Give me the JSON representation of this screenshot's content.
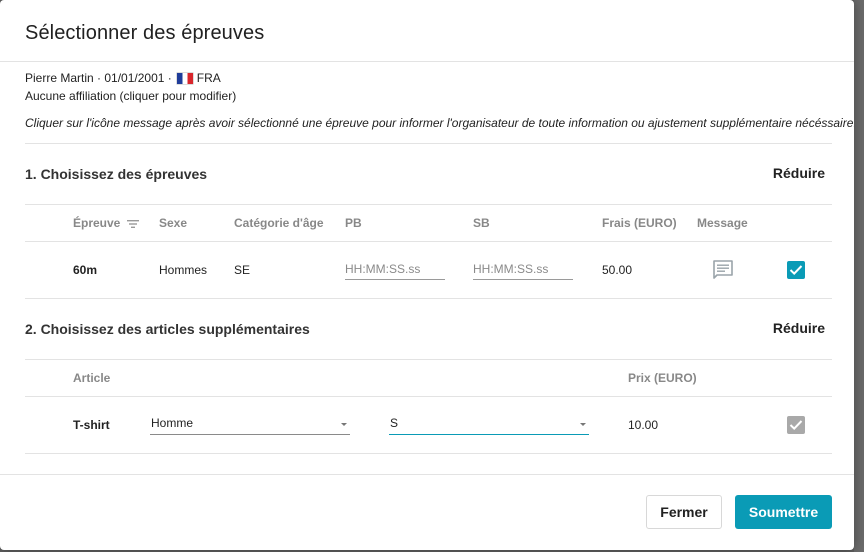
{
  "modal": {
    "title": "Sélectionner des épreuves",
    "athlete": {
      "name": "Pierre Martin",
      "separator": "·",
      "birthdate": "01/01/2001",
      "country": "FRA"
    },
    "affiliation": "Aucune affiliation (cliquer pour modifier)",
    "info_note": "Cliquer sur l'icône message après avoir sélectionné une épreuve pour informer l'organisateur de toute information ou ajustement supplémentaire nécéssaire."
  },
  "events_section": {
    "title": "1. Choisissez des épreuves",
    "collapse_label": "Réduire",
    "columns": {
      "event": "Épreuve",
      "sex": "Sexe",
      "age_category": "Catégorie d'âge",
      "pb": "PB",
      "sb": "SB",
      "fee": "Frais (EURO)",
      "message": "Message"
    },
    "rows": [
      {
        "event": "60m",
        "sex": "Hommes",
        "age_category": "SE",
        "pb_placeholder": "HH:MM:SS.ss",
        "sb_placeholder": "HH:MM:SS.ss",
        "fee": "50.00",
        "selected": true
      }
    ]
  },
  "items_section": {
    "title": "2. Choisissez des articles supplémentaires",
    "collapse_label": "Réduire",
    "columns": {
      "article": "Article",
      "price": "Prix (EURO)"
    },
    "rows": [
      {
        "article": "T-shirt",
        "variant": "Homme",
        "size": "S",
        "price": "10.00",
        "selected": true
      }
    ]
  },
  "footer": {
    "close_label": "Fermer",
    "submit_label": "Soumettre"
  },
  "colors": {
    "accent": "#0a9bb6",
    "checkbox_disabled": "#a9a9a9",
    "backdrop": "#5f5f5f"
  },
  "icons": {
    "sort": "sort-lines-icon",
    "message": "comment-icon",
    "check": "check-icon",
    "flag": "flag-france-icon",
    "dropdown": "caret-down-icon"
  }
}
